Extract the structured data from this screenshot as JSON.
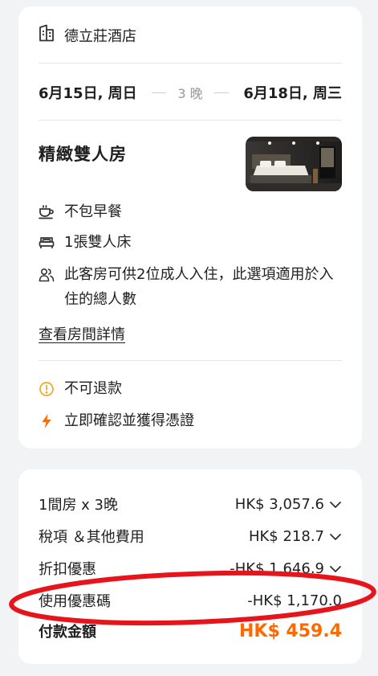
{
  "booking": {
    "hotel_name": "德立莊酒店",
    "checkin": "6月15日, 周日",
    "nights": "3 晚",
    "checkout": "6月18日, 周三",
    "room_name": "精緻雙人房",
    "features": [
      {
        "icon": "coffee-cup-icon",
        "text": "不包早餐"
      },
      {
        "icon": "bed-icon",
        "text": "1張雙人床"
      },
      {
        "icon": "people-icon",
        "text": "此客房可供2位成人入住，此選項適用於入住的總人數"
      }
    ],
    "details_link": "查看房間詳情",
    "policies": [
      {
        "icon": "info-circle-icon",
        "text": "不可退款",
        "color": "#f5a623"
      },
      {
        "icon": "lightning-icon",
        "text": "立即確認並獲得憑證",
        "color": "#ff6a00"
      }
    ]
  },
  "price": {
    "rows": [
      {
        "label": "1間房 x 3晚",
        "amount": "HK$ 3,057.6",
        "expandable": true
      },
      {
        "label": "稅項 ＆其他費用",
        "amount": "HK$ 218.7",
        "expandable": true
      },
      {
        "label": "折扣優惠",
        "amount": "-HK$ 1,646.9",
        "expandable": true
      },
      {
        "label": "使用優惠碼",
        "amount": "-HK$ 1,170.0",
        "expandable": false
      }
    ],
    "total_label": "付款金額",
    "total_amount": "HK$ 459.4"
  },
  "colors": {
    "accent_orange": "#ff6a00",
    "warning_yellow": "#f5a623",
    "highlight_red": "#e8141b"
  }
}
